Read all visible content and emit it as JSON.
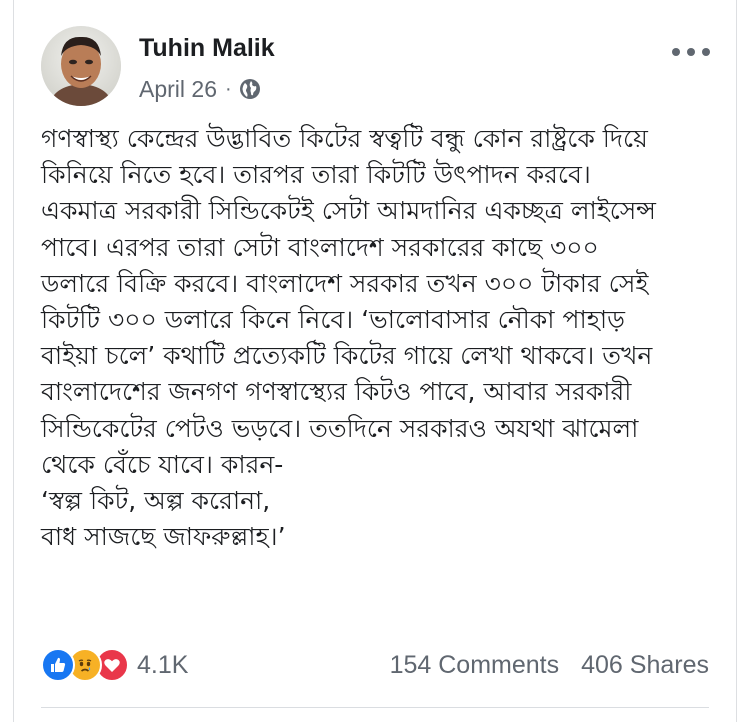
{
  "post": {
    "author": "Tuhin Malik",
    "date": "April 26",
    "separator": "·",
    "privacy_icon": "globe-icon",
    "more_icon": "more-options-icon",
    "body_lines": [
      "গণস্বাস্থ্য কেন্দ্রের উদ্ভাবিত কিটের স্বত্বটি বন্ধু কোন রাষ্ট্রকে দিয়ে",
      "কিনিয়ে নিতে হবে। তারপর তারা কিটটি উৎপাদন করবে।",
      "একমাত্র সরকারী সিন্ডিকেটই সেটা আমদানির একচ্ছত্র লাইসেন্স",
      "পাবে। এরপর তারা সেটা বাংলাদেশ সরকারের কাছে ৩০০",
      "ডলারে বিক্রি করবে। বাংলাদেশ সরকার তখন ৩০০ টাকার সেই",
      "কিটটি ৩০০ ডলারে কিনে নিবে। ‘ভালোবাসার নৌকা পাহাড়",
      "বাইয়া চলে’ কথাটি প্রত্যেকটি কিটের গায়ে লেখা থাকবে। তখন",
      "বাংলাদেশের জনগণ গণস্বাস্থ্যের কিটও পাবে, আবার সরকারী",
      "সিন্ডিকেটের পেটও ভড়বে। ততদিনে সরকারও অযথা ঝামেলা",
      "থেকে বেঁচে যাবে। কারন-",
      "‘স্বল্প কিট, অল্প করোনা,",
      "বাধ সাজছে জাফরুল্লাহ।’"
    ]
  },
  "footer": {
    "reaction_icons": [
      "like-icon",
      "sad-icon",
      "love-icon"
    ],
    "reaction_count": "4.1K",
    "comments": "154 Comments",
    "shares": "406 Shares"
  },
  "colors": {
    "like": "#1877f2",
    "sad": "#f7b125",
    "love": "#e9374a",
    "secondary_text": "#606770"
  }
}
